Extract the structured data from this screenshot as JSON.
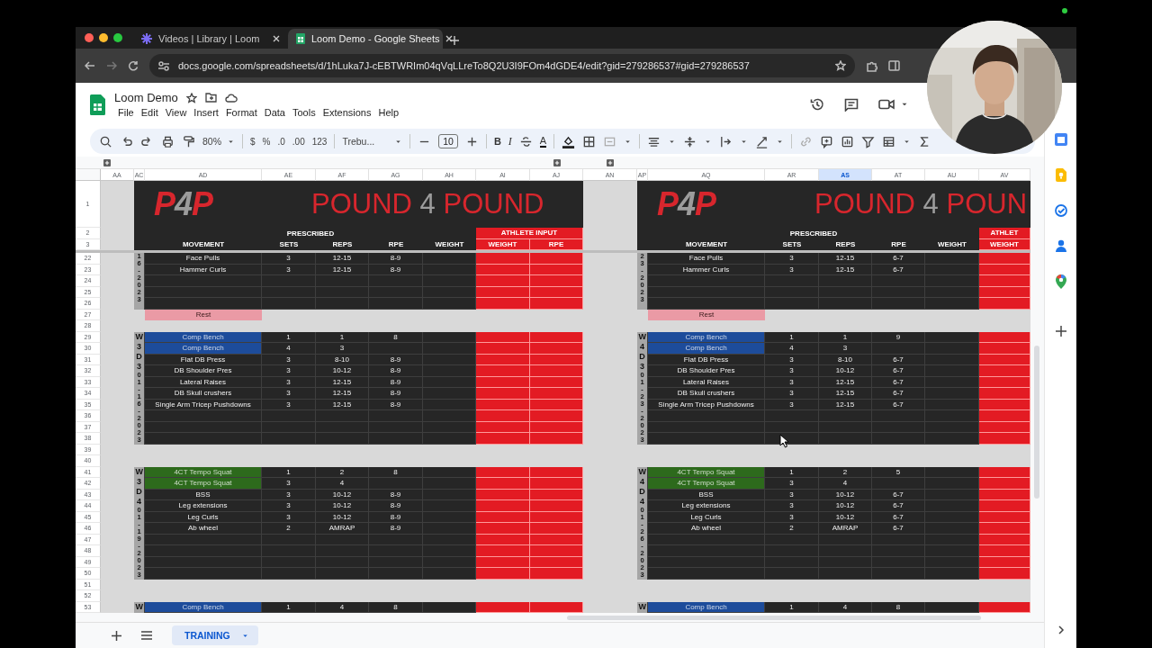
{
  "browser": {
    "tabs": [
      {
        "title": "Videos | Library | Loom",
        "selected": false
      },
      {
        "title": "Loom Demo - Google Sheets",
        "selected": true
      }
    ],
    "url": "docs.google.com/spreadsheets/d/1hLuka7J-cEBTWRIm04qVqLLreTo8Q2U3I9FOm4dGDE4/edit?gid=279286537#gid=279286537"
  },
  "document": {
    "title": "Loom Demo",
    "menu": [
      "File",
      "Edit",
      "View",
      "Insert",
      "Format",
      "Data",
      "Tools",
      "Extensions",
      "Help"
    ]
  },
  "toolbar": {
    "zoom": "80%",
    "currency": "$",
    "percent": "%",
    "decrease_decimal": ".0",
    "increase_decimal": ".00",
    "number_format": "123",
    "font": "Trebu...",
    "font_size": "10",
    "bold": "B",
    "italic": "I",
    "text_color": "A"
  },
  "columns": [
    {
      "label": "AA",
      "selected": false
    },
    {
      "label": "AC",
      "selected": false
    },
    {
      "label": "AD",
      "selected": false
    },
    {
      "label": "AE",
      "selected": false
    },
    {
      "label": "AF",
      "selected": false
    },
    {
      "label": "AG",
      "selected": false
    },
    {
      "label": "AH",
      "selected": false
    },
    {
      "label": "AI",
      "selected": false
    },
    {
      "label": "AJ",
      "selected": false
    },
    {
      "label": "AN",
      "selected": false
    },
    {
      "label": "AP",
      "selected": false
    },
    {
      "label": "AQ",
      "selected": false
    },
    {
      "label": "AR",
      "selected": false
    },
    {
      "label": "AS",
      "selected": true
    },
    {
      "label": "AT",
      "selected": false
    },
    {
      "label": "AU",
      "selected": false
    },
    {
      "label": "AV",
      "selected": false
    }
  ],
  "row_numbers": [
    "1",
    "2",
    "3",
    "22",
    "23",
    "24",
    "25",
    "26",
    "27",
    "28",
    "29",
    "30",
    "31",
    "32",
    "33",
    "34",
    "35",
    "36",
    "37",
    "38",
    "39",
    "40",
    "41",
    "42",
    "43",
    "44",
    "45",
    "46",
    "47",
    "48",
    "49",
    "50",
    "51",
    "52",
    "53"
  ],
  "panels": [
    {
      "logo": [
        {
          "text": "P",
          "color": "#d7262d"
        },
        {
          "text": "4",
          "color": "#9c9c9c"
        },
        {
          "text": "P",
          "color": "#d7262d"
        }
      ],
      "title": [
        {
          "text": "POUND",
          "color": "#d7262d"
        },
        {
          "text": "4",
          "color": "#9c9c9c"
        },
        {
          "text": "POUND",
          "color": "#d7262d"
        }
      ],
      "prescribed": "PRESCRIBED",
      "athlete_input": "ATHLETE INPUT",
      "headers": [
        "MOVEMENT",
        "SETS",
        "REPS",
        "RPE",
        "WEIGHT",
        "WEIGHT",
        "RPE"
      ],
      "rows": [
        {
          "kind": "exercise",
          "strip": {
            "date": "16-2023"
          },
          "movement": "Face Pulls",
          "sets": "3",
          "reps": "12-15",
          "rpe": "8-9"
        },
        {
          "kind": "exercise",
          "movement": "Hammer Curls",
          "sets": "3",
          "reps": "12-15",
          "rpe": "8-9"
        },
        {
          "kind": "empty"
        },
        {
          "kind": "empty"
        },
        {
          "kind": "empty"
        },
        {
          "kind": "rest",
          "label": "Rest"
        },
        {
          "kind": "space"
        },
        {
          "kind": "exercise",
          "strip": {
            "label": "W3D3",
            "date": "01-16-2023"
          },
          "movement": "Comp Bench",
          "sets": "1",
          "reps": "1",
          "rpe": "8",
          "color": "#1d4c9b"
        },
        {
          "kind": "exercise",
          "movement": "Comp Bench",
          "sets": "4",
          "reps": "3",
          "color": "#1d4c9b"
        },
        {
          "kind": "exercise",
          "movement": "Flat DB Press",
          "sets": "3",
          "reps": "8-10",
          "rpe": "8-9"
        },
        {
          "kind": "exercise",
          "movement": "DB Shoulder Pres",
          "sets": "3",
          "reps": "10-12",
          "rpe": "8-9"
        },
        {
          "kind": "exercise",
          "movement": "Lateral Raises",
          "sets": "3",
          "reps": "12-15",
          "rpe": "8-9"
        },
        {
          "kind": "exercise",
          "movement": "DB Skull crushers",
          "sets": "3",
          "reps": "12-15",
          "rpe": "8-9"
        },
        {
          "kind": "exercise",
          "movement": "Single Arm Tricep Pushdowns",
          "sets": "3",
          "reps": "12-15",
          "rpe": "8-9"
        },
        {
          "kind": "empty"
        },
        {
          "kind": "empty"
        },
        {
          "kind": "empty"
        },
        {
          "kind": "space"
        },
        {
          "kind": "space"
        },
        {
          "kind": "exercise",
          "strip": {
            "label": "W3D4",
            "date": "01-19-2023"
          },
          "movement": "4CT Tempo Squat",
          "sets": "1",
          "reps": "2",
          "rpe": "8",
          "color": "#2d6a1c"
        },
        {
          "kind": "exercise",
          "movement": "4CT Tempo Squat",
          "sets": "3",
          "reps": "4",
          "color": "#2d6a1c"
        },
        {
          "kind": "exercise",
          "movement": "BSS",
          "sets": "3",
          "reps": "10-12",
          "rpe": "8-9"
        },
        {
          "kind": "exercise",
          "movement": "Leg extensions",
          "sets": "3",
          "reps": "10-12",
          "rpe": "8-9"
        },
        {
          "kind": "exercise",
          "movement": "Leg Curls",
          "sets": "3",
          "reps": "10-12",
          "rpe": "8-9"
        },
        {
          "kind": "exercise",
          "movement": "Ab wheel",
          "sets": "2",
          "reps": "AMRAP",
          "rpe": "8-9"
        },
        {
          "kind": "empty"
        },
        {
          "kind": "empty"
        },
        {
          "kind": "empty"
        },
        {
          "kind": "empty"
        },
        {
          "kind": "space"
        },
        {
          "kind": "space"
        },
        {
          "kind": "exercise",
          "strip": {
            "label": "W"
          },
          "movement": "Comp Bench",
          "sets": "1",
          "reps": "4",
          "rpe": "8",
          "color": "#1d4c9b"
        }
      ]
    },
    {
      "logo": [
        {
          "text": "P",
          "color": "#d7262d"
        },
        {
          "text": "4",
          "color": "#9c9c9c"
        },
        {
          "text": "P",
          "color": "#d7262d"
        }
      ],
      "title": [
        {
          "text": "POUND",
          "color": "#d7262d"
        },
        {
          "text": "4",
          "color": "#9c9c9c"
        },
        {
          "text": "POUN",
          "color": "#d7262d"
        }
      ],
      "prescribed": "PRESCRIBED",
      "athlete_input": "ATHLET",
      "headers": [
        "MOVEMENT",
        "SETS",
        "REPS",
        "RPE",
        "WEIGHT",
        "WEIGHT"
      ],
      "rows": [
        {
          "kind": "exercise",
          "strip": {
            "date": "23-2023"
          },
          "movement": "Face Pulls",
          "sets": "3",
          "reps": "12-15",
          "rpe": "6-7"
        },
        {
          "kind": "exercise",
          "movement": "Hammer Curls",
          "sets": "3",
          "reps": "12-15",
          "rpe": "6-7"
        },
        {
          "kind": "empty"
        },
        {
          "kind": "empty"
        },
        {
          "kind": "empty"
        },
        {
          "kind": "rest",
          "label": "Rest"
        },
        {
          "kind": "space"
        },
        {
          "kind": "exercise",
          "strip": {
            "label": "W4D3",
            "date": "01-23-2023"
          },
          "movement": "Comp Bench",
          "sets": "1",
          "reps": "1",
          "rpe": "9",
          "color": "#1d4c9b"
        },
        {
          "kind": "exercise",
          "movement": "Comp Bench",
          "sets": "4",
          "reps": "3",
          "color": "#1d4c9b"
        },
        {
          "kind": "exercise",
          "movement": "Flat DB Press",
          "sets": "3",
          "reps": "8-10",
          "rpe": "6-7"
        },
        {
          "kind": "exercise",
          "movement": "DB Shoulder Pres",
          "sets": "3",
          "reps": "10-12",
          "rpe": "6-7"
        },
        {
          "kind": "exercise",
          "movement": "Lateral Raises",
          "sets": "3",
          "reps": "12-15",
          "rpe": "6-7"
        },
        {
          "kind": "exercise",
          "movement": "DB Skull crushers",
          "sets": "3",
          "reps": "12-15",
          "rpe": "6-7"
        },
        {
          "kind": "exercise",
          "movement": "Single Arm Tricep Pushdowns",
          "sets": "3",
          "reps": "12-15",
          "rpe": "6-7"
        },
        {
          "kind": "empty"
        },
        {
          "kind": "empty"
        },
        {
          "kind": "empty"
        },
        {
          "kind": "space"
        },
        {
          "kind": "space"
        },
        {
          "kind": "exercise",
          "strip": {
            "label": "W4D4",
            "date": "01-26-2023"
          },
          "movement": "4CT Tempo Squat",
          "sets": "1",
          "reps": "2",
          "rpe": "5",
          "color": "#2d6a1c"
        },
        {
          "kind": "exercise",
          "movement": "4CT Tempo Squat",
          "sets": "3",
          "reps": "4",
          "color": "#2d6a1c"
        },
        {
          "kind": "exercise",
          "movement": "BSS",
          "sets": "3",
          "reps": "10-12",
          "rpe": "6-7"
        },
        {
          "kind": "exercise",
          "movement": "Leg extensions",
          "sets": "3",
          "reps": "10-12",
          "rpe": "6-7"
        },
        {
          "kind": "exercise",
          "movement": "Leg Curls",
          "sets": "3",
          "reps": "10-12",
          "rpe": "6-7"
        },
        {
          "kind": "exercise",
          "movement": "Ab wheel",
          "sets": "2",
          "reps": "AMRAP",
          "rpe": "6-7"
        },
        {
          "kind": "empty"
        },
        {
          "kind": "empty"
        },
        {
          "kind": "empty"
        },
        {
          "kind": "empty"
        },
        {
          "kind": "space"
        },
        {
          "kind": "space"
        },
        {
          "kind": "exercise",
          "strip": {
            "label": "W"
          },
          "movement": "Comp Bench",
          "sets": "1",
          "reps": "4",
          "rpe": "8",
          "color": "#1d4c9b"
        }
      ]
    }
  ],
  "sheet_tab": {
    "label": "TRAINING",
    "selected": true
  }
}
